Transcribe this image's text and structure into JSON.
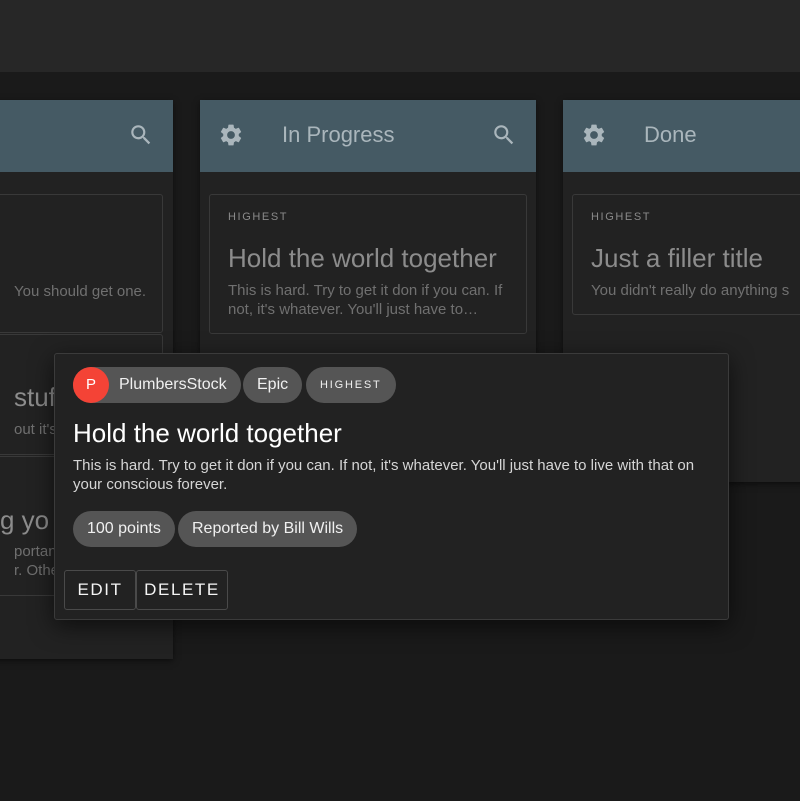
{
  "columns": [
    {
      "title": "",
      "tasks": [
        {
          "desc_fragment": "You should get one."
        },
        {
          "title_fragment": "stuff",
          "desc_fragment": "out it's fu"
        },
        {
          "title_fragment": "g yo",
          "desc_lines": [
            "portant t",
            "r. Other"
          ]
        }
      ]
    },
    {
      "title": "In Progress",
      "tasks": [
        {
          "priority": "HIGHEST",
          "title": "Hold the world together",
          "description": "This is hard. Try to get it don if you can. If not, it's whatever. You'll just have to…"
        }
      ]
    },
    {
      "title": "Done",
      "tasks": [
        {
          "priority": "HIGHEST",
          "title": "Just a filler title",
          "description": "You didn't really do anything s"
        }
      ]
    }
  ],
  "detail": {
    "avatar_letter": "P",
    "avatar_color": "#f44336",
    "project": "PlumbersStock",
    "type": "Epic",
    "priority": "HIGHEST",
    "title": "Hold the world together",
    "description": "This is hard. Try to get it don if you can. If not, it's whatever. You'll just have to live with that on your conscious forever.",
    "points": "100 points",
    "reporter": "Reported by Bill Wills",
    "edit_label": "EDIT",
    "delete_label": "DELETE"
  },
  "colors": {
    "column_header": "#455a64",
    "background": "#1a1a1a",
    "card": "#222222",
    "chip": "#555555"
  },
  "icons": [
    "gear-icon",
    "search-icon"
  ]
}
